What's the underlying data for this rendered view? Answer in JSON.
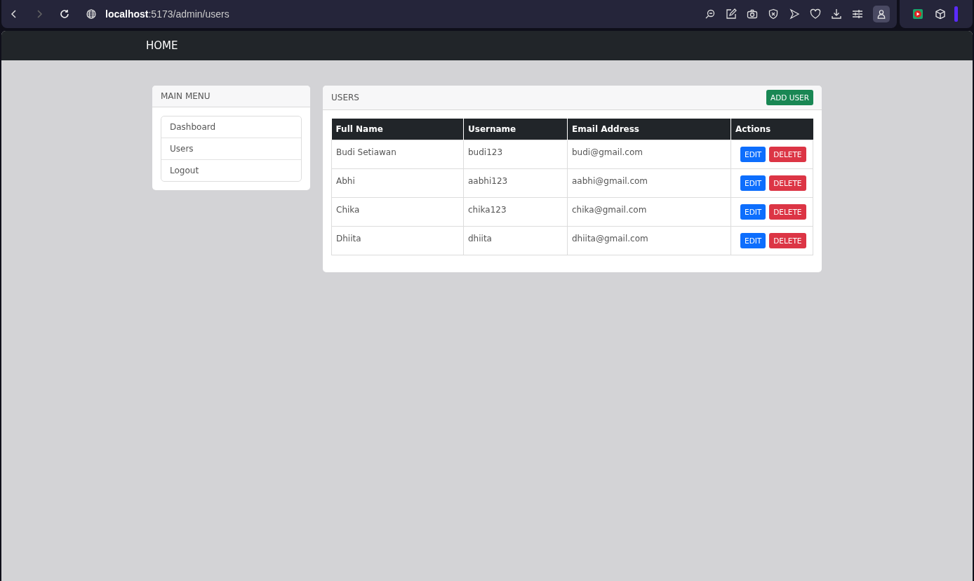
{
  "browser": {
    "url_host": "localhost",
    "url_path": ":5173/admin/users"
  },
  "navbar": {
    "brand": "HOME"
  },
  "sidebar": {
    "title": "MAIN MENU",
    "items": [
      "Dashboard",
      "Users",
      "Logout"
    ]
  },
  "users_panel": {
    "title": "USERS",
    "add_button": "ADD USER",
    "columns": [
      "Full Name",
      "Username",
      "Email Address",
      "Actions"
    ],
    "rows": [
      {
        "full_name": "Budi Setiawan",
        "username": "budi123",
        "email": "budi@gmail.com",
        "edit": "EDIT",
        "delete": "DELETE"
      },
      {
        "full_name": "Abhi",
        "username": "aabhi123",
        "email": "aabhi@gmail.com",
        "edit": "EDIT",
        "delete": "DELETE"
      },
      {
        "full_name": "Chika",
        "username": "chika123",
        "email": "chika@gmail.com",
        "edit": "EDIT",
        "delete": "DELETE"
      },
      {
        "full_name": "Dhiita",
        "username": "dhiita",
        "email": "dhiita@gmail.com",
        "edit": "EDIT",
        "delete": "DELETE"
      }
    ]
  }
}
